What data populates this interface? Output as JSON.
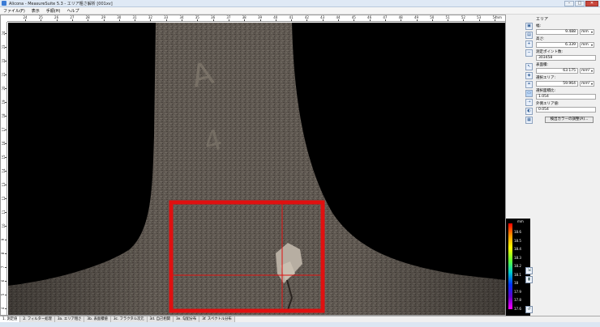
{
  "window": {
    "title": "Alicona - MeasureSuite 5.3 - エリア粗さ解析 [001xv]",
    "buttons": [
      "–",
      "□",
      "✕"
    ]
  },
  "menu": [
    "ファイル(F)",
    "表示",
    "手順(H)",
    "ヘルプ"
  ],
  "ruler": {
    "top": [
      "24",
      "25",
      "26",
      "27",
      "28",
      "29",
      "30",
      "31",
      "32",
      "33",
      "34",
      "35",
      "36",
      "37",
      "38",
      "39",
      "40",
      "41",
      "42",
      "43",
      "44",
      "45",
      "46",
      "47",
      "48",
      "49",
      "50",
      "51",
      "52",
      "53",
      "54"
    ],
    "top_unit": "mm",
    "left": [
      "24",
      "23",
      "22",
      "21",
      "20",
      "19",
      "18",
      "17",
      "16",
      "15",
      "14",
      "13",
      "12",
      "11",
      "10",
      "9",
      "8",
      "7",
      "6",
      "5",
      "4"
    ]
  },
  "side_tools": [
    {
      "icon": "cube-view-icon",
      "glyph": "▣"
    },
    {
      "icon": "image-icon",
      "glyph": "▤"
    },
    {
      "icon": "zoom-in-icon",
      "glyph": "+"
    },
    {
      "icon": "zoom-out-icon",
      "glyph": "−"
    },
    {
      "icon": "pointer-icon",
      "glyph": "↖"
    },
    {
      "icon": "select-icon",
      "glyph": "◈"
    },
    {
      "icon": "crop-icon",
      "glyph": "⌗"
    },
    {
      "icon": "rect-select-icon",
      "glyph": "▭"
    },
    {
      "icon": "measure-icon",
      "glyph": "⇢"
    },
    {
      "icon": "color-icon",
      "glyph": "◐"
    },
    {
      "icon": "grid-icon",
      "glyph": "▦"
    }
  ],
  "props": {
    "section": "エリア",
    "width_label": "幅:",
    "width_value": "9.488",
    "width_unit": "mm",
    "height_label": "高さ:",
    "height_value": "6.339",
    "height_unit": "mm",
    "points_label": "測定ポイント数:",
    "points_value": "303458",
    "area_label": "表面積:",
    "area_value": "63.175",
    "area_unit": "mm²",
    "sel_area_label": "選択エリア:",
    "sel_area_value": "59.964",
    "sel_area_unit": "mm²",
    "ratio_label": "選択面積比:",
    "ratio_value": "1.054",
    "ext_label": "外側エリア値:",
    "ext_value": "0.054",
    "button_label": "検出カラーの調整(A)..."
  },
  "colorbar": {
    "unit": "mm",
    "labels": [
      "18.6",
      "18.5",
      "18.4",
      "18.3",
      "18.2",
      "18.1",
      "18",
      "17.9",
      "17.8",
      "17.6"
    ]
  },
  "view_buttons": [
    "⇲",
    "▮",
    "↺"
  ],
  "tabs": [
    "1. 測定値",
    "2. フィルター処理",
    "3a. エリア粗さ",
    "3b. 表面積値",
    "3c. フラクタル次元",
    "3d. 自己相関",
    "3e. 勾配分布",
    "3f. スペクトル分布"
  ],
  "colors": {
    "selection": "#e01010",
    "accent": "#3a7bd5"
  }
}
